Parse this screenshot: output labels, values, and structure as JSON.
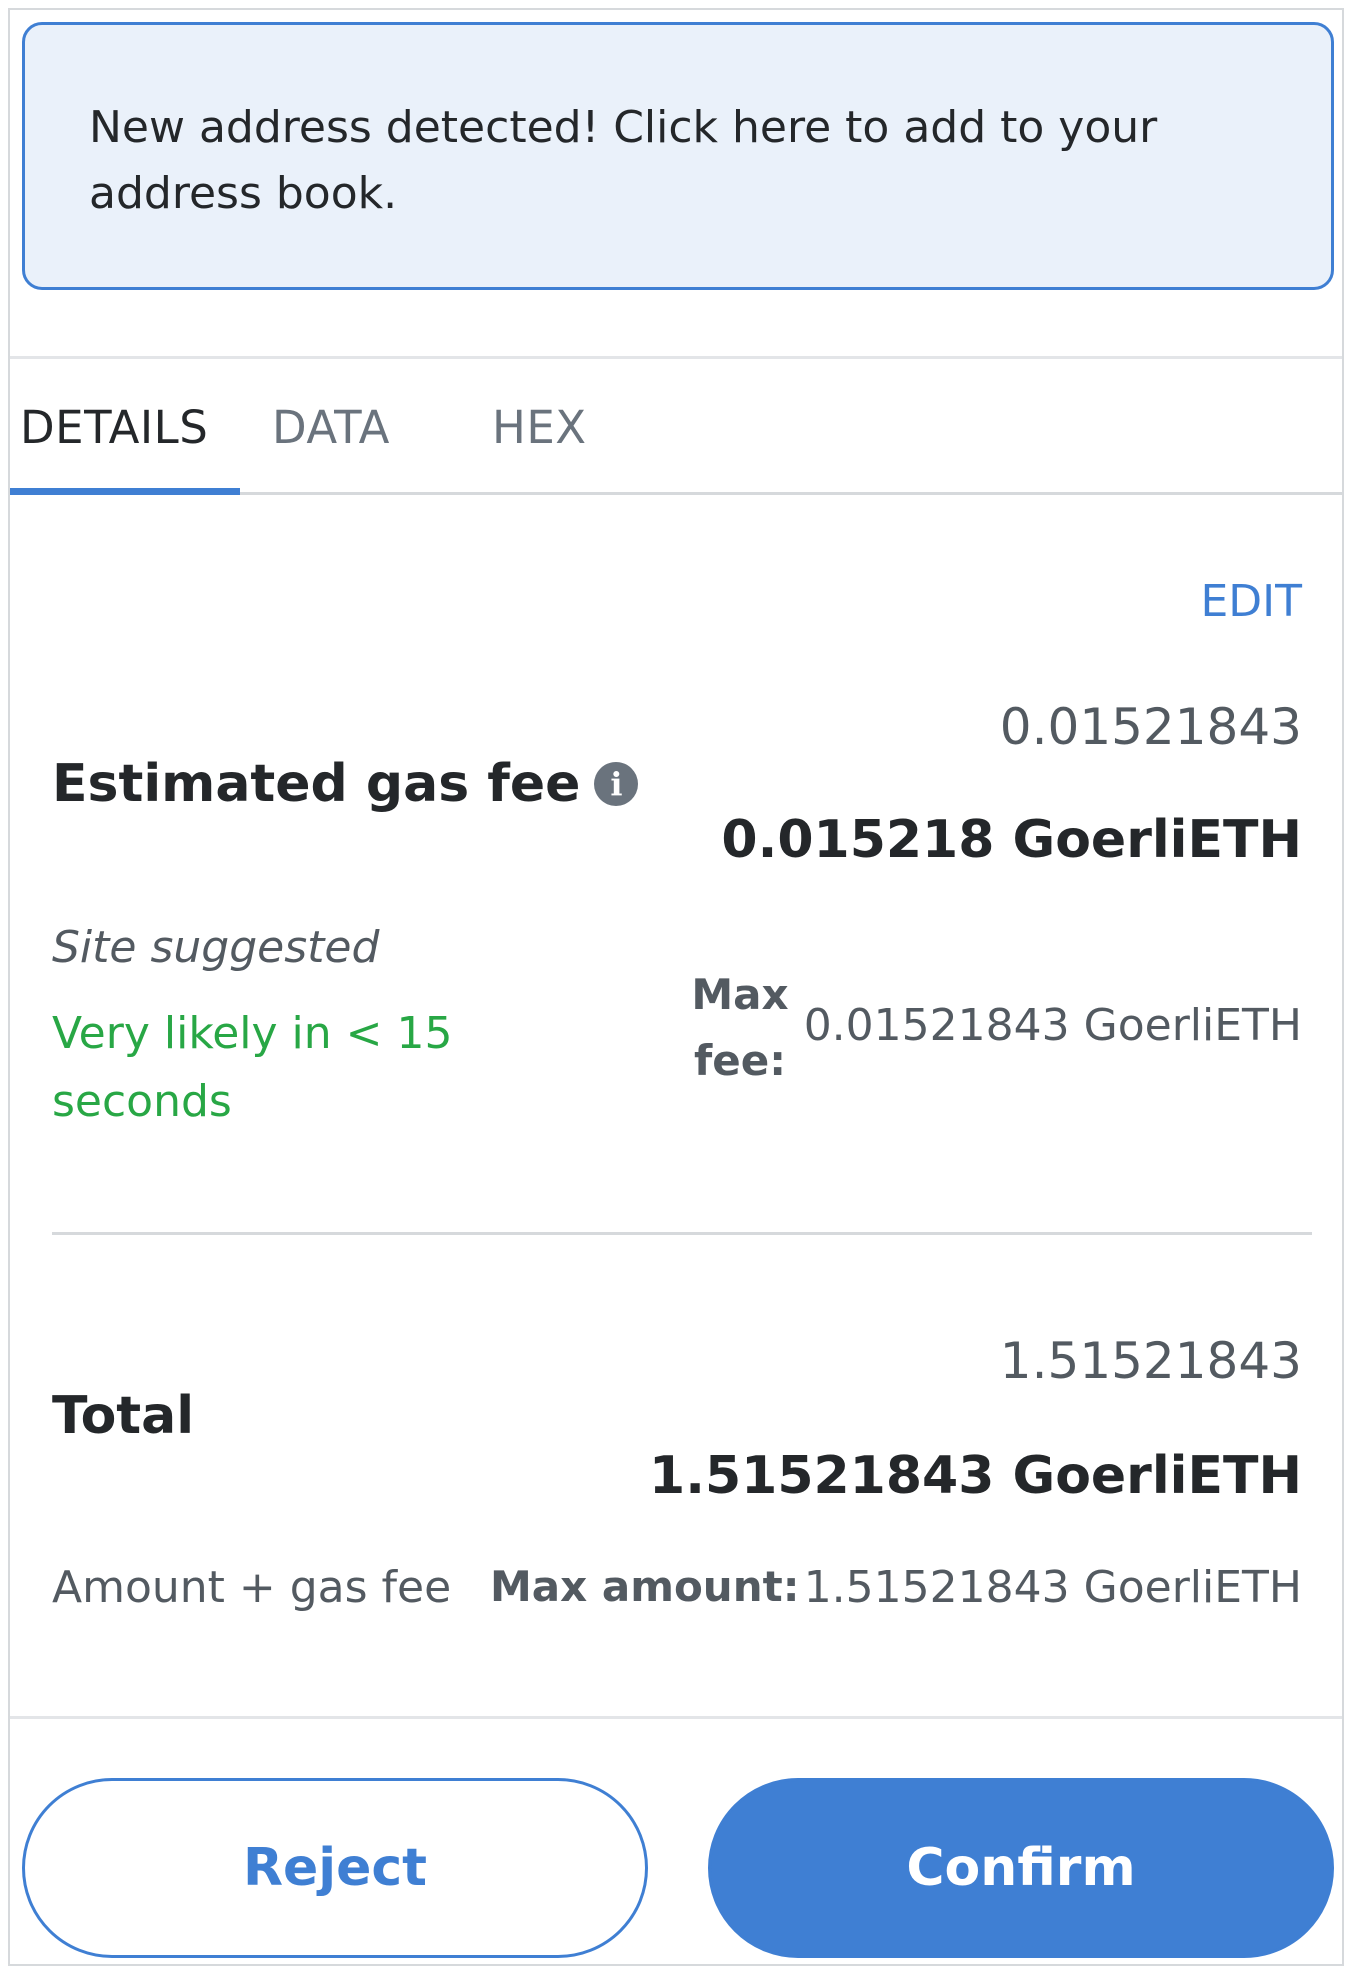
{
  "notice": {
    "text": "New address detected! Click here to add to your address book."
  },
  "tabs": [
    {
      "label": "DETAILS",
      "active": true
    },
    {
      "label": "DATA",
      "active": false
    },
    {
      "label": "HEX",
      "active": false
    }
  ],
  "details": {
    "edit_label": "EDIT",
    "gas": {
      "label": "Estimated gas fee",
      "info_icon": "i",
      "fiat_value": "0.01521843",
      "native_value": "0.015218 GoerliETH",
      "site_suggested": "Site suggested",
      "likelihood": "Very likely in < 15 seconds",
      "max_fee_label": "Max fee:",
      "max_fee_value": "0.01521843 GoerliETH"
    },
    "total": {
      "label": "Total",
      "fiat_value": "1.51521843",
      "native_value": "1.51521843 GoerliETH",
      "subtitle": "Amount + gas fee",
      "max_amount_label": "Max amount:",
      "max_amount_value": "1.51521843 GoerliETH"
    }
  },
  "footer": {
    "reject_label": "Reject",
    "confirm_label": "Confirm"
  },
  "colors": {
    "accent": "#3f7fd3",
    "notice_bg": "#eaf1fa",
    "success": "#28a745",
    "text_primary": "#24272a",
    "text_muted": "#535a61"
  }
}
